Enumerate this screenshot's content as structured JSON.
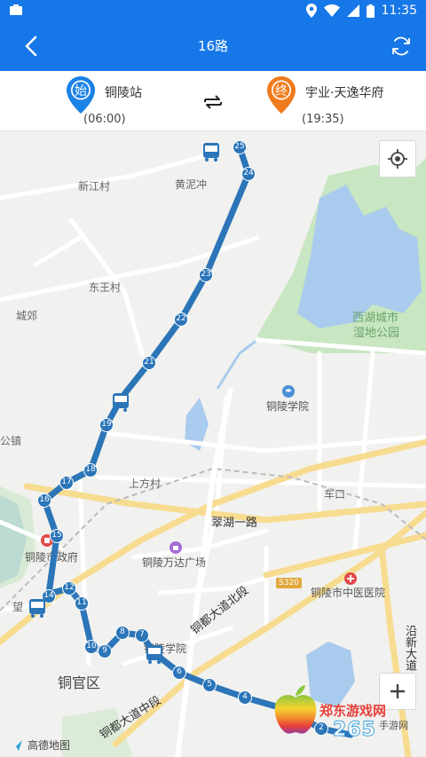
{
  "status_bar": {
    "time": "11:35"
  },
  "header": {
    "title": "16路"
  },
  "stations": {
    "start": {
      "badge": "始",
      "name": "铜陵站",
      "time": "(06:00)",
      "color": "#1b82e6"
    },
    "end": {
      "badge": "终",
      "name": "宇业·天逸华府",
      "time": "(19:35)",
      "color": "#f07b1c"
    }
  },
  "map": {
    "places": [
      "新江村",
      "黄泥冲",
      "东王村",
      "城郊",
      "西湖城市",
      "湿地公园",
      "铜陵学院",
      "公镇",
      "上方村",
      "车口",
      "翠湖一路",
      "铜陵市政府",
      "铜陵万达广场",
      "S320",
      "铜陵市中医医院",
      "望",
      "铜官区",
      "铜都大道北段",
      "铜都大道中段",
      "铜陵学院",
      "沿新大道"
    ],
    "stops": [
      "25",
      "24",
      "23",
      "22",
      "21",
      "19",
      "18",
      "17",
      "16",
      "15",
      "14",
      "12",
      "11",
      "10",
      "9",
      "8",
      "7",
      "6",
      "5",
      "4",
      "2"
    ],
    "route_color": "#2b75b8",
    "provider": "高德地图",
    "watermark": {
      "title": "郑东游戏网",
      "number": "265",
      "suffix": "手游网"
    }
  }
}
